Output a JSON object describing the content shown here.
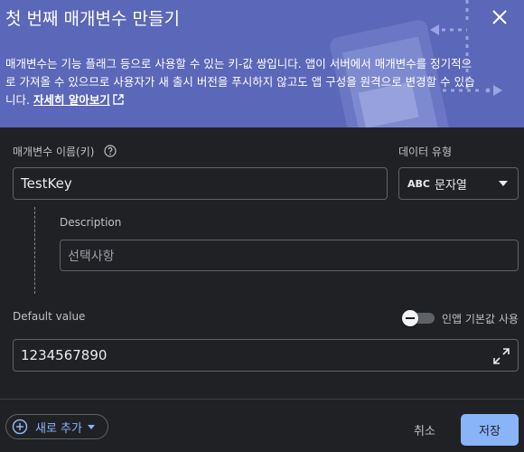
{
  "dialog": {
    "title": "첫 번째 매개변수 만들기",
    "description": "매개변수는 기능 플래그 등으로 사용할 수 있는 키-값 쌍입니다. 앱이 서버에서 매개변수를 정기적으로 가져올 수 있으므로 사용자가 새 출시 버전을 푸시하지 않고도 앱 구성을 원격으로 변경할 수 있습니다.",
    "learn_more": "자세히 알아보기"
  },
  "form": {
    "param_name_label": "매개변수 이름(키)",
    "param_name_value": "TestKey",
    "data_type_label": "데이터 유형",
    "data_type_icon_text": "ABC",
    "data_type_value": "문자열",
    "description_label": "Description",
    "description_placeholder": "선택사항",
    "default_value_label": "Default value",
    "in_app_default_label": "인앱 기본값 사용",
    "default_value": "1234567890"
  },
  "footer": {
    "add_new_label": "새로 추가",
    "cancel_label": "취소",
    "save_label": "저장"
  },
  "colors": {
    "header_bg": "#5b67b8",
    "accent": "#8ab4f8",
    "surface": "#202124"
  }
}
